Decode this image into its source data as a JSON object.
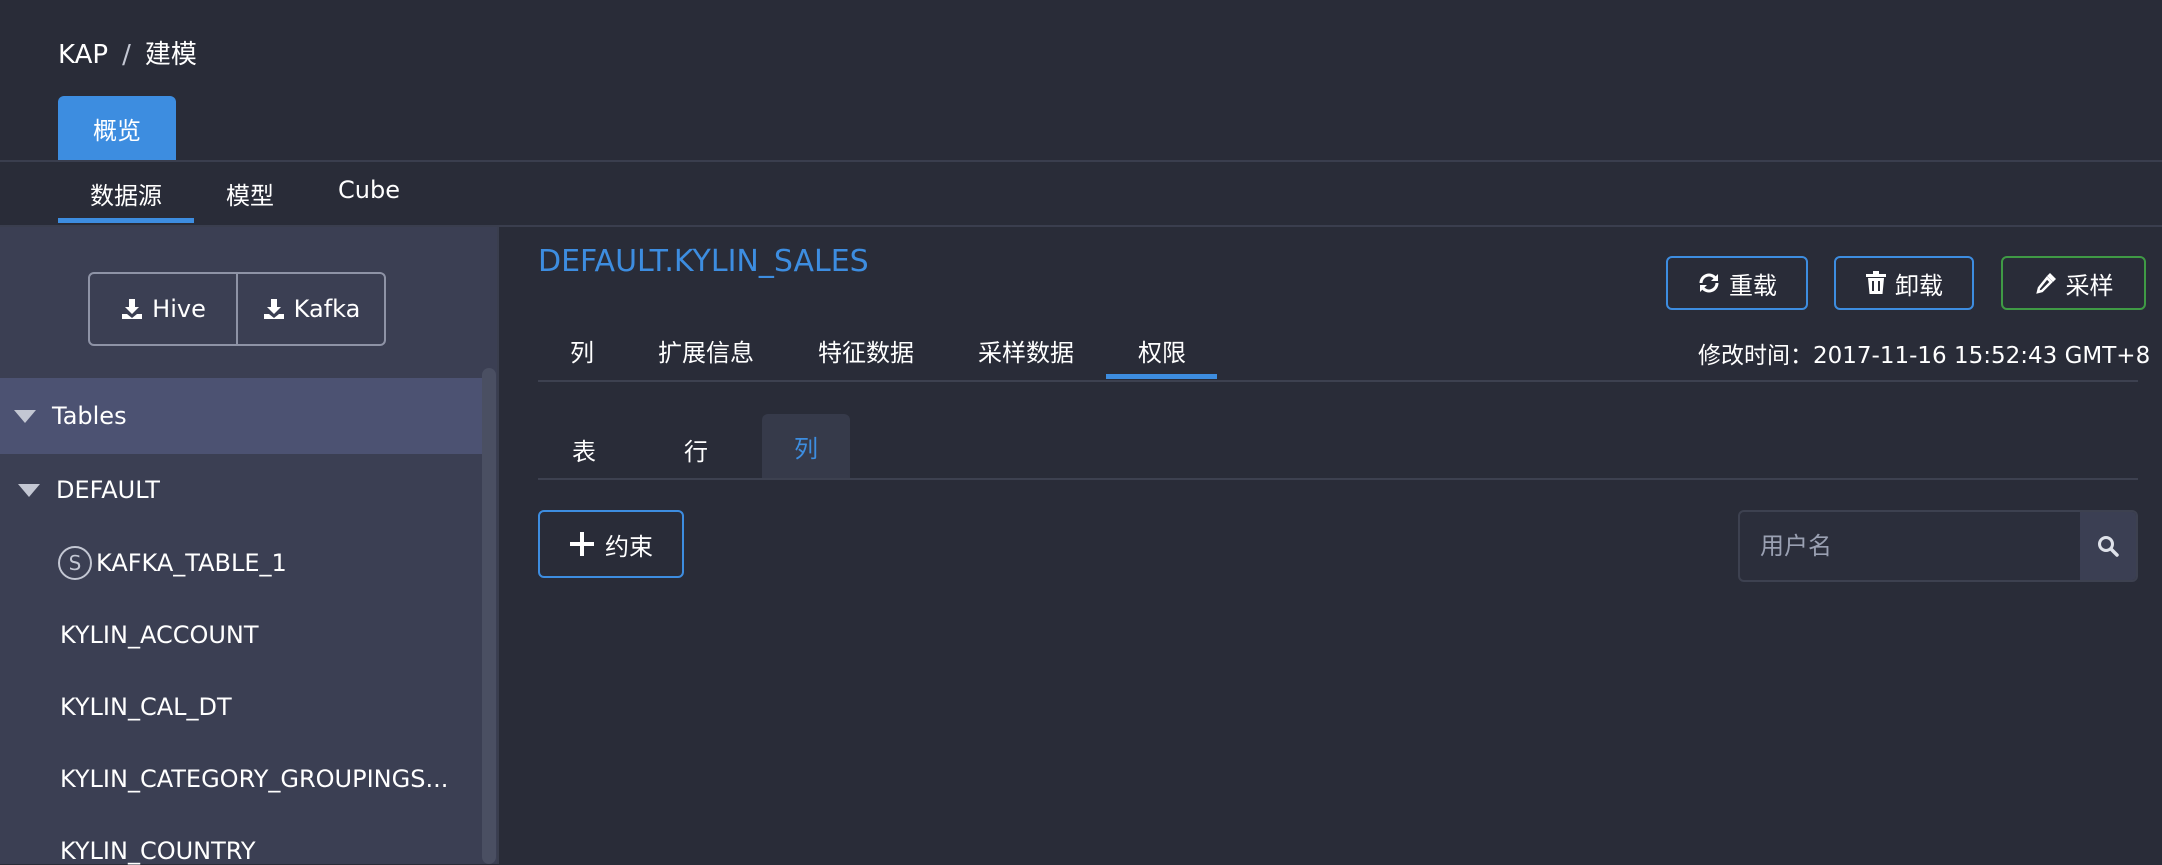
{
  "breadcrumb": {
    "root": "KAP",
    "separator": "/",
    "current": "建模"
  },
  "top_tab": {
    "label": "概览"
  },
  "sub_tabs": [
    {
      "label": "数据源",
      "active": true
    },
    {
      "label": "模型",
      "active": false
    },
    {
      "label": "Cube",
      "active": false
    }
  ],
  "sidebar": {
    "load_buttons": {
      "hive": "Hive",
      "kafka": "Kafka"
    },
    "tables_header": "Tables",
    "database": "DEFAULT",
    "streaming_badge": "S",
    "tables": [
      "KAFKA_TABLE_1",
      "KYLIN_ACCOUNT",
      "KYLIN_CAL_DT",
      "KYLIN_CATEGORY_GROUPINGS...",
      "KYLIN_COUNTRY"
    ]
  },
  "main": {
    "table_title": "DEFAULT.KYLIN_SALES",
    "actions": {
      "reload": "重载",
      "unload": "卸载",
      "sample": "采样"
    },
    "tabs": [
      {
        "label": "列",
        "active": false
      },
      {
        "label": "扩展信息",
        "active": false
      },
      {
        "label": "特征数据",
        "active": false
      },
      {
        "label": "采样数据",
        "active": false
      },
      {
        "label": "权限",
        "active": true
      }
    ],
    "modified_label": "修改时间：",
    "modified_value": "2017-11-16 15:52:43 GMT+8",
    "permission_tabs": [
      {
        "label": "表",
        "active": false
      },
      {
        "label": "行",
        "active": false
      },
      {
        "label": "列",
        "active": true
      }
    ],
    "add_constraint_label": "约束",
    "search": {
      "placeholder": "用户名",
      "value": ""
    }
  },
  "colors": {
    "accent": "#3d8de0",
    "background": "#292c38",
    "sidebar": "#3b3f53",
    "selected_row": "#4c5272",
    "sample_border": "#3f9a45"
  },
  "icons": {
    "hive_button": "download-icon",
    "kafka_button": "download-icon",
    "reload_button": "refresh-icon",
    "unload_button": "trash-icon",
    "sample_button": "eyedropper-icon",
    "add_constraint_button": "plus-icon",
    "search_button": "search-icon"
  }
}
